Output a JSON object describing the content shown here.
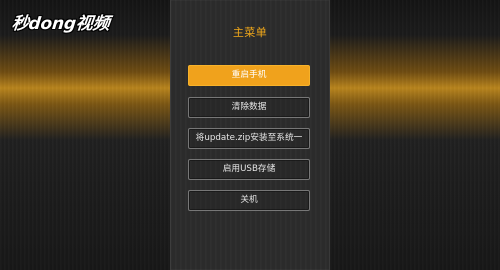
{
  "watermark": {
    "text": "秒dong视频"
  },
  "menu": {
    "title": "主菜单",
    "items": [
      {
        "label": "重启手机",
        "selected": true
      },
      {
        "label": "清除数据",
        "selected": false
      },
      {
        "label": "将update.zip安装至系统一",
        "selected": false
      },
      {
        "label": "启用USB存储",
        "selected": false
      },
      {
        "label": "关机",
        "selected": false
      }
    ]
  },
  "colors": {
    "accent": "#f0a21c",
    "panel_bg": "#2c2c2c",
    "button_border": "#777777",
    "title_color": "#f2a91a"
  }
}
